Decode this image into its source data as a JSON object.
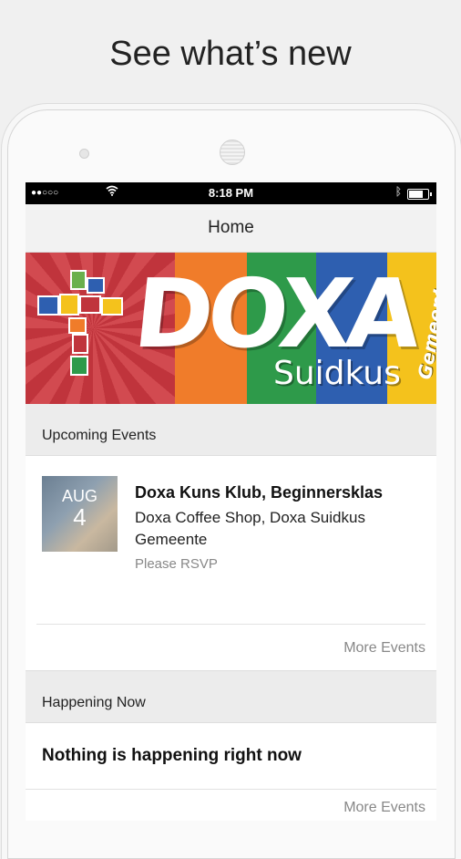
{
  "headline": "See what’s new",
  "status": {
    "time": "8:18 PM",
    "signal": "●●○○○",
    "battery_level": 0.85
  },
  "nav": {
    "title": "Home"
  },
  "banner": {
    "brand": "DOXA",
    "subtitle": "Suidkus",
    "vertical": "Gemeente",
    "colors": [
      "#c0343c",
      "#f07c2a",
      "#2e9a4a",
      "#2e5fb0",
      "#f4c21c"
    ]
  },
  "upcoming": {
    "header": "Upcoming Events",
    "event": {
      "month": "AUG",
      "day": "4",
      "title": "Doxa Kuns Klub, Beginnersklas",
      "location": "Doxa Coffee Shop, Doxa Suidkus Gemeente",
      "note": "Please RSVP"
    },
    "more_label": "More Events"
  },
  "happening": {
    "header": "Happening Now",
    "empty_text": "Nothing is happening right now",
    "more_label": "More Events"
  }
}
